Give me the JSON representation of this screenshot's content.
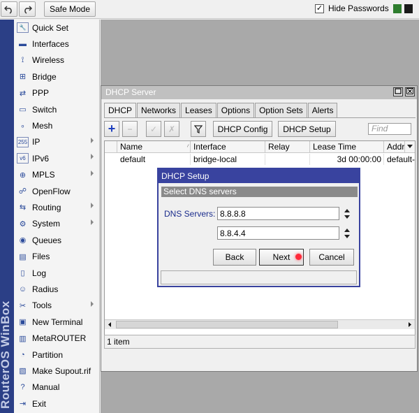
{
  "toolbar": {
    "undo_icon": "undo-icon",
    "redo_icon": "redo-icon",
    "safe_mode": "Safe Mode",
    "hide_passwords_label": "Hide Passwords",
    "hide_passwords_checked": "✓",
    "status_colors": [
      "#2e7d2e",
      "#1a1a1a"
    ]
  },
  "brand": {
    "text": "RouterOS WinBox"
  },
  "sidebar": {
    "items": [
      {
        "label": "Quick Set",
        "icon": "quickset-icon",
        "glyph": "🔧",
        "submenu": false
      },
      {
        "label": "Interfaces",
        "icon": "interfaces-icon",
        "glyph": "▬",
        "submenu": false
      },
      {
        "label": "Wireless",
        "icon": "wireless-icon",
        "glyph": "⟟",
        "submenu": false
      },
      {
        "label": "Bridge",
        "icon": "bridge-icon",
        "glyph": "⊞",
        "submenu": false
      },
      {
        "label": "PPP",
        "icon": "ppp-icon",
        "glyph": "⇄",
        "submenu": false
      },
      {
        "label": "Switch",
        "icon": "switch-icon",
        "glyph": "▭",
        "submenu": false
      },
      {
        "label": "Mesh",
        "icon": "mesh-icon",
        "glyph": "∘",
        "submenu": false
      },
      {
        "label": "IP",
        "icon": "ip-icon",
        "glyph": "255",
        "submenu": true
      },
      {
        "label": "IPv6",
        "icon": "ipv6-icon",
        "glyph": "v6",
        "submenu": true
      },
      {
        "label": "MPLS",
        "icon": "mpls-icon",
        "glyph": "⊕",
        "submenu": true
      },
      {
        "label": "OpenFlow",
        "icon": "openflow-icon",
        "glyph": "☍",
        "submenu": false
      },
      {
        "label": "Routing",
        "icon": "routing-icon",
        "glyph": "⇆",
        "submenu": true
      },
      {
        "label": "System",
        "icon": "system-icon",
        "glyph": "⚙",
        "submenu": true
      },
      {
        "label": "Queues",
        "icon": "queues-icon",
        "glyph": "◉",
        "submenu": false
      },
      {
        "label": "Files",
        "icon": "files-icon",
        "glyph": "▤",
        "submenu": false
      },
      {
        "label": "Log",
        "icon": "log-icon",
        "glyph": "▯",
        "submenu": false
      },
      {
        "label": "Radius",
        "icon": "radius-icon",
        "glyph": "☺",
        "submenu": false
      },
      {
        "label": "Tools",
        "icon": "tools-icon",
        "glyph": "✂",
        "submenu": true
      },
      {
        "label": "New Terminal",
        "icon": "terminal-icon",
        "glyph": "▣",
        "submenu": false
      },
      {
        "label": "MetaROUTER",
        "icon": "metarouter-icon",
        "glyph": "▥",
        "submenu": false
      },
      {
        "label": "Partition",
        "icon": "partition-icon",
        "glyph": "◔",
        "submenu": false
      },
      {
        "label": "Make Supout.rif",
        "icon": "supout-icon",
        "glyph": "▧",
        "submenu": false
      },
      {
        "label": "Manual",
        "icon": "manual-icon",
        "glyph": "?",
        "submenu": false
      },
      {
        "label": "Exit",
        "icon": "exit-icon",
        "glyph": "⇥",
        "submenu": false
      }
    ]
  },
  "dhcp_window": {
    "title": "DHCP Server",
    "tabs": [
      "DHCP",
      "Networks",
      "Leases",
      "Options",
      "Option Sets",
      "Alerts"
    ],
    "buttons": {
      "add": "+",
      "remove": "−",
      "enable": "✓",
      "disable": "✗",
      "filter": "⏷",
      "dhcp_config": "DHCP Config",
      "dhcp_setup": "DHCP Setup"
    },
    "find_placeholder": "Find",
    "columns": [
      "Name",
      "Interface",
      "Relay",
      "Lease Time",
      "Addr"
    ],
    "rows": [
      {
        "name": "default",
        "interface": "bridge-local",
        "relay": "",
        "lease_time": "3d 00:00:00",
        "addr": "default-c"
      }
    ],
    "status": "1 item"
  },
  "setup_dialog": {
    "title": "DHCP Setup",
    "subtitle": "Select DNS servers",
    "dns_label": "DNS Servers:",
    "dns_1": "8.8.8.8",
    "dns_2": "8.8.4.4",
    "back": "Back",
    "next": "Next",
    "cancel": "Cancel"
  }
}
